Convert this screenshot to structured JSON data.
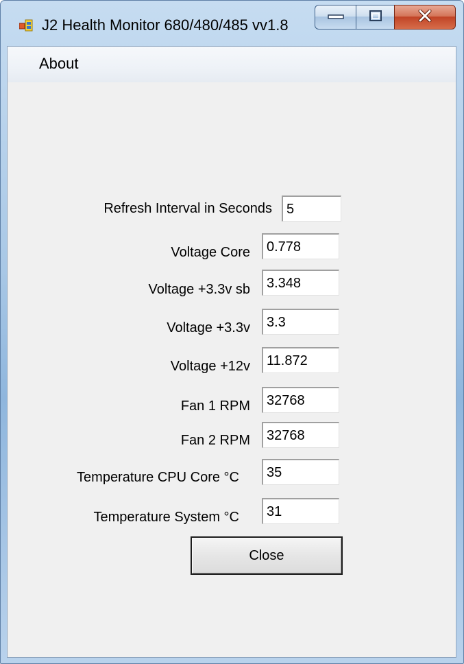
{
  "window": {
    "title": "J2 Health Monitor 680/480/485 vv1.8",
    "controls": {
      "minimize": "minimize-icon",
      "maximize": "maximize-icon",
      "close": "close-icon"
    },
    "accent_color": "#c14427"
  },
  "menu": {
    "items": [
      {
        "label": "About"
      }
    ]
  },
  "form": {
    "refresh_interval": {
      "label": "Refresh Interval in Seconds",
      "value": "5"
    },
    "voltage_core": {
      "label": "Voltage Core",
      "value": "0.778"
    },
    "voltage_33_sb": {
      "label": "Voltage +3.3v sb",
      "value": "3.348"
    },
    "voltage_33": {
      "label": "Voltage +3.3v",
      "value": "3.3"
    },
    "voltage_12": {
      "label": "Voltage +12v",
      "value": "11.872"
    },
    "fan1": {
      "label": "Fan 1  RPM",
      "value": "32768"
    },
    "fan2": {
      "label": "Fan 2  RPM",
      "value": "32768"
    },
    "temp_cpu": {
      "label": "Temperature CPU Core  °C",
      "value": "35"
    },
    "temp_system": {
      "label": "Temperature System  °C",
      "value": "31"
    }
  },
  "buttons": {
    "close_label": "Close"
  }
}
